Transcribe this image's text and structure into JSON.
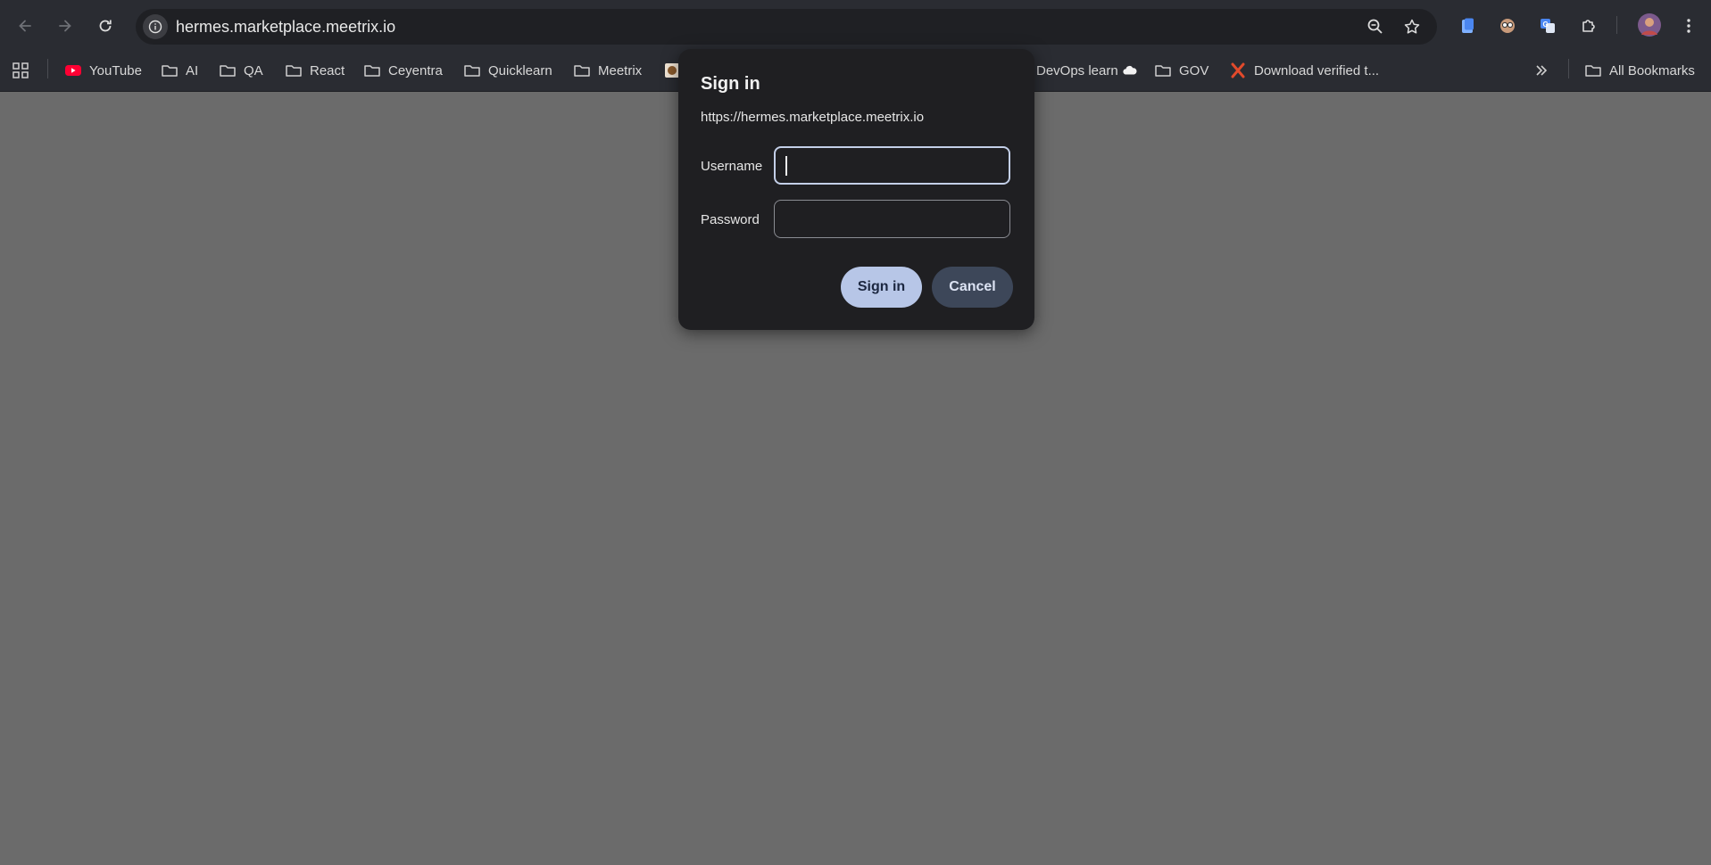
{
  "browser": {
    "url": "hermes.marketplace.meetrix.io"
  },
  "bookmarks": {
    "items": [
      {
        "label": "YouTube",
        "icon": "youtube-icon"
      },
      {
        "label": "AI",
        "icon": "folder-icon"
      },
      {
        "label": "QA",
        "icon": "folder-icon"
      },
      {
        "label": "React",
        "icon": "folder-icon"
      },
      {
        "label": "Ceyentra",
        "icon": "folder-icon"
      },
      {
        "label": "Quicklearn",
        "icon": "folder-icon"
      },
      {
        "label": "Meetrix",
        "icon": "folder-icon"
      },
      {
        "label": "DevOps learn",
        "icon": "cloud-icon"
      },
      {
        "label": "GOV",
        "icon": "folder-icon"
      },
      {
        "label": "Download verified t...",
        "icon": "x-logo-icon"
      }
    ],
    "all_bookmarks": "All Bookmarks"
  },
  "dialog": {
    "title": "Sign in",
    "origin": "https://hermes.marketplace.meetrix.io",
    "username_label": "Username",
    "password_label": "Password",
    "username_value": "",
    "password_value": "",
    "sign_in_label": "Sign in",
    "cancel_label": "Cancel"
  },
  "colors": {
    "page_background": "#6b6b6b",
    "chrome_background": "#2a2c32",
    "dialog_background": "#1f1f22",
    "primary_button": "#b7c6e7",
    "secondary_button": "#3d4759"
  }
}
